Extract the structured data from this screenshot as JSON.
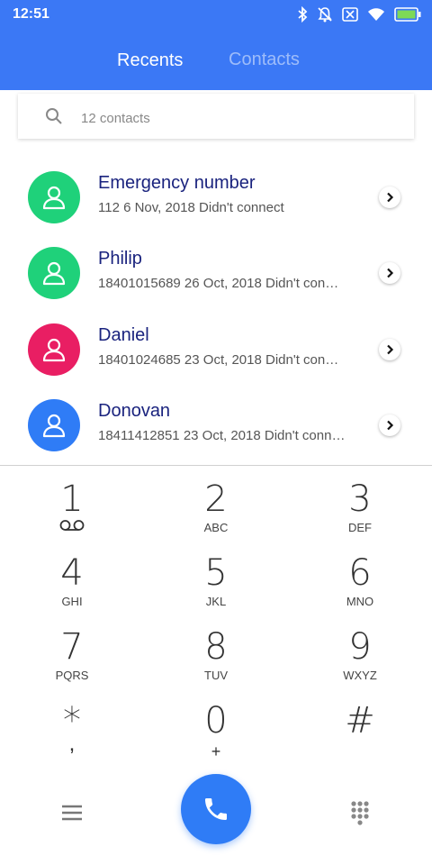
{
  "status_bar": {
    "time": "12:51",
    "icons": [
      "bluetooth-icon",
      "notifications-off-icon",
      "sim-icon",
      "wifi-icon",
      "battery-icon"
    ],
    "battery_color": "#7ed957"
  },
  "header": {
    "tabs": [
      {
        "label": "Recents",
        "active": true
      },
      {
        "label": "Contacts",
        "active": false
      }
    ],
    "color": "#3b78f5"
  },
  "search": {
    "placeholder": "12 contacts",
    "value": ""
  },
  "recents": [
    {
      "name": "Emergency number",
      "detail": "112  6 Nov, 2018 Didn't connect",
      "avatar_color": "#1fd17a"
    },
    {
      "name": "Philip",
      "detail": "18401015689  26 Oct, 2018 Didn't connect",
      "avatar_color": "#1fd17a"
    },
    {
      "name": "Daniel",
      "detail": "18401024685  23 Oct, 2018 Didn't connect",
      "avatar_color": "#e91e63"
    },
    {
      "name": "Donovan",
      "detail": "18411412851  23 Oct, 2018 Didn't connect",
      "avatar_color": "#2f7cf6"
    }
  ],
  "dialpad": {
    "keys": [
      {
        "digit": "1",
        "letters": ""
      },
      {
        "digit": "2",
        "letters": "ABC"
      },
      {
        "digit": "3",
        "letters": "DEF"
      },
      {
        "digit": "4",
        "letters": "GHI"
      },
      {
        "digit": "5",
        "letters": "JKL"
      },
      {
        "digit": "6",
        "letters": "MNO"
      },
      {
        "digit": "7",
        "letters": "PQRS"
      },
      {
        "digit": "8",
        "letters": "TUV"
      },
      {
        "digit": "9",
        "letters": "WXYZ"
      },
      {
        "digit": "*",
        "letters": ","
      },
      {
        "digit": "0",
        "letters": "+"
      },
      {
        "digit": "#",
        "letters": ""
      }
    ]
  },
  "bottom_bar": {
    "menu_icon": "menu-icon",
    "call_icon": "phone-icon",
    "call_color": "#2f7cf6",
    "dialpad_icon": "dialpad-icon"
  }
}
